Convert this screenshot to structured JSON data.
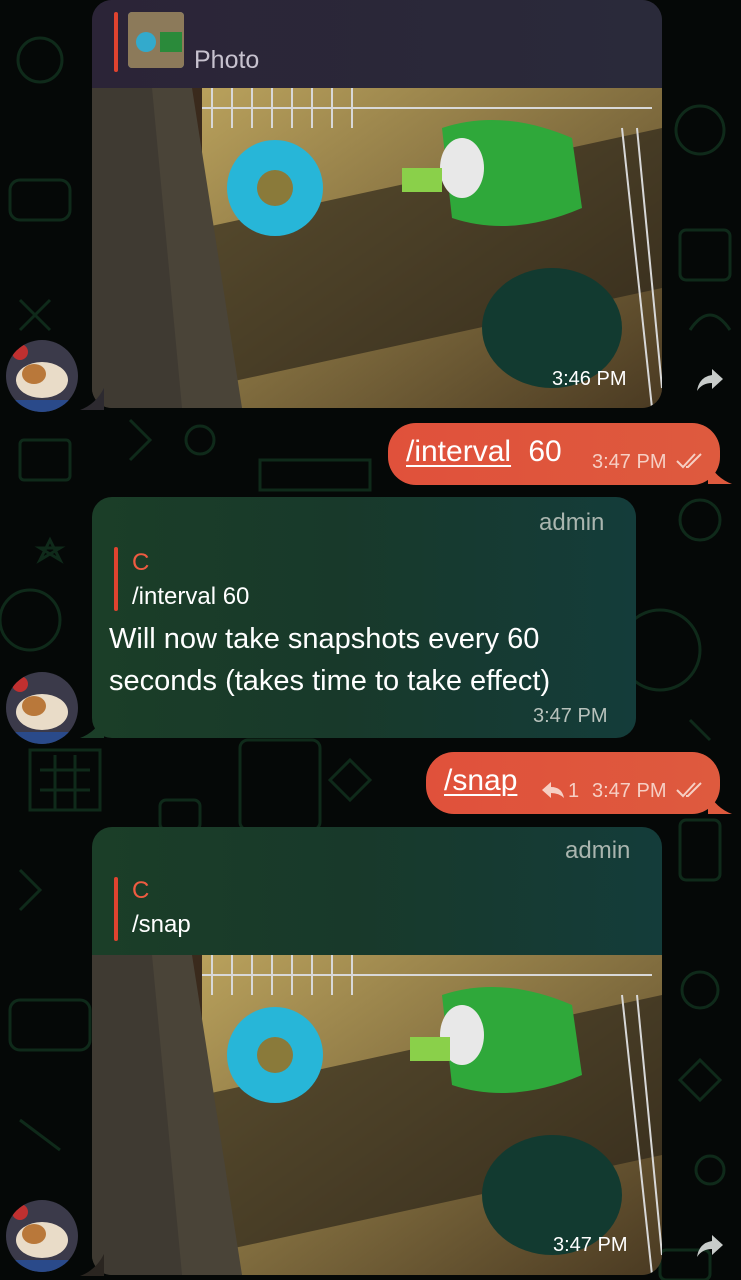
{
  "colors": {
    "background": "#050807",
    "incoming_bubble": "#1b3e28",
    "outgoing_bubble": "#e0513b",
    "reply_accent": "#e0432f",
    "doodle": "#0f2a1a"
  },
  "messages": [
    {
      "type": "photo",
      "direction": "incoming",
      "reply_preview": {
        "label": "Photo",
        "thumbnail_icon": "photo-thumbnail"
      },
      "time": "3:46 PM",
      "forward_icon": "forward-arrow-icon"
    },
    {
      "type": "text",
      "direction": "outgoing",
      "command": "/interval",
      "text_rest": " 60",
      "time": "3:47 PM",
      "status_icon": "double-check-icon"
    },
    {
      "type": "text",
      "direction": "incoming",
      "sender": "admin",
      "reply": {
        "name": "C",
        "text": "/interval 60"
      },
      "body_line1": "Will now take snapshots every 60",
      "body_line2": "seconds (takes time to take effect)",
      "time": "3:47 PM"
    },
    {
      "type": "text",
      "direction": "outgoing",
      "command": "/snap",
      "replies_count": "1",
      "replies_icon": "reply-arrow-icon",
      "time": "3:47 PM",
      "status_icon": "double-check-icon"
    },
    {
      "type": "photo",
      "direction": "incoming",
      "sender": "admin",
      "reply": {
        "name": "C",
        "text": "/snap"
      },
      "time": "3:47 PM",
      "forward_icon": "forward-arrow-icon"
    }
  ]
}
